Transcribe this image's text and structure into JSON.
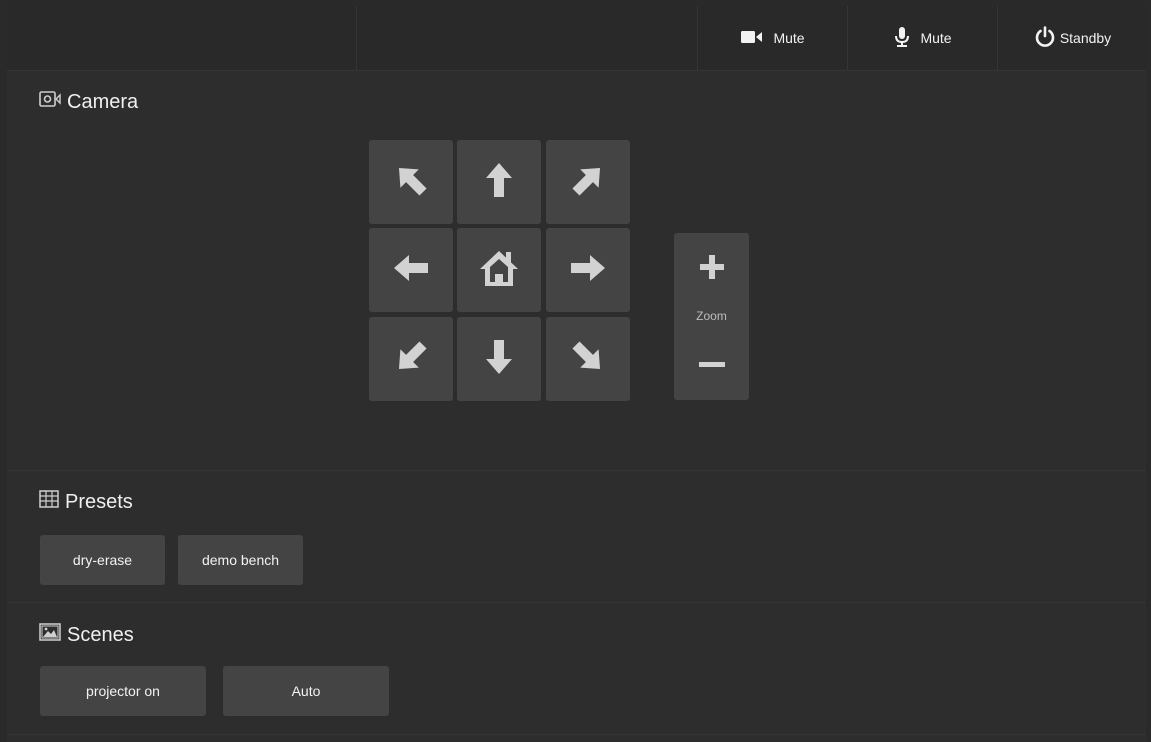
{
  "topbar": {
    "camera_mute": {
      "label": "Mute",
      "icon": "video-camera-icon"
    },
    "mic_mute": {
      "label": "Mute",
      "icon": "microphone-icon"
    },
    "standby": {
      "label": "Standby",
      "icon": "power-icon"
    }
  },
  "camera": {
    "title": "Camera",
    "icon": "camera-settings-icon",
    "pad": [
      {
        "name": "pan-up-left-button",
        "icon": "arrow-up-left-icon"
      },
      {
        "name": "tilt-up-button",
        "icon": "arrow-up-icon"
      },
      {
        "name": "pan-up-right-button",
        "icon": "arrow-up-right-icon"
      },
      {
        "name": "pan-left-button",
        "icon": "arrow-left-icon"
      },
      {
        "name": "home-button",
        "icon": "home-icon"
      },
      {
        "name": "pan-right-button",
        "icon": "arrow-right-icon"
      },
      {
        "name": "pan-down-left-button",
        "icon": "arrow-down-left-icon"
      },
      {
        "name": "tilt-down-button",
        "icon": "arrow-down-icon"
      },
      {
        "name": "pan-down-right-button",
        "icon": "arrow-down-right-icon"
      }
    ],
    "zoom": {
      "label": "Zoom",
      "in_icon": "plus-icon",
      "out_icon": "minus-icon"
    }
  },
  "presets": {
    "title": "Presets",
    "icon": "grid-icon",
    "items": [
      "dry-erase",
      "demo bench"
    ]
  },
  "scenes": {
    "title": "Scenes",
    "icon": "picture-icon",
    "items": [
      "projector on",
      "Auto"
    ]
  },
  "colors": {
    "background": "#2d2d2d",
    "button": "#444444",
    "icon": "#d2d2d2",
    "text": "#f0f0f0"
  }
}
